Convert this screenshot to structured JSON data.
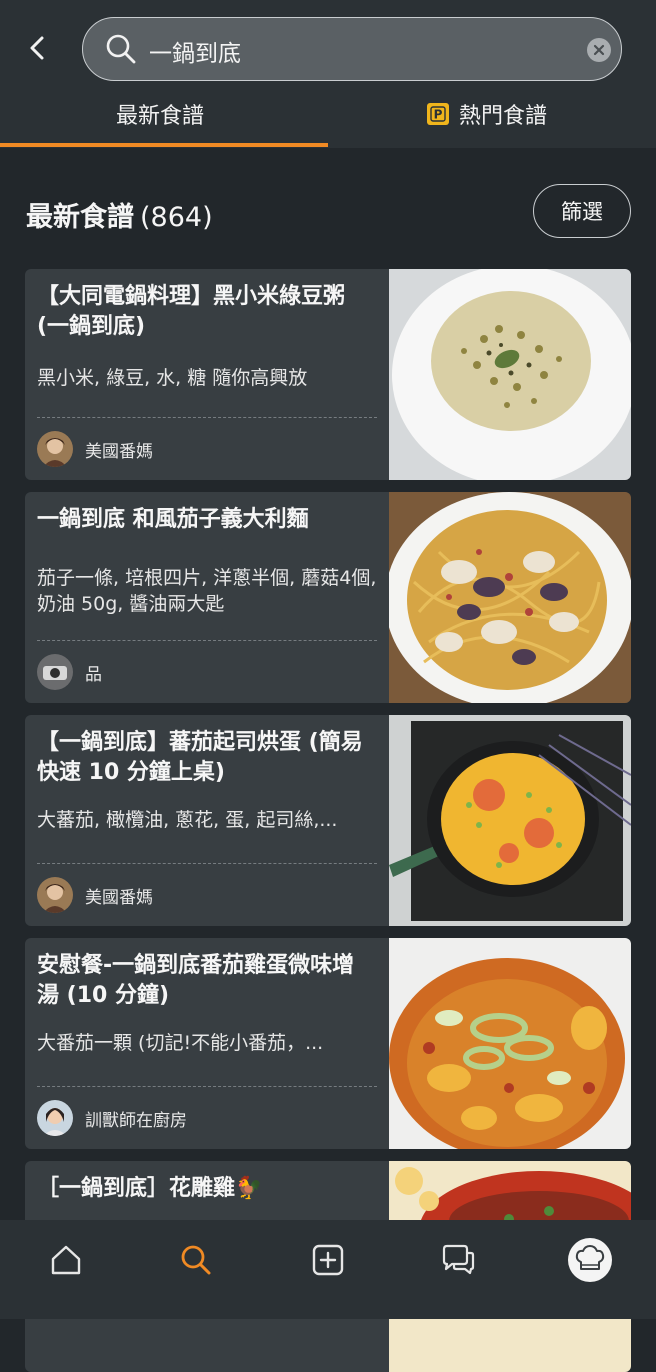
{
  "search": {
    "query": "一鍋到底"
  },
  "tabs": {
    "latest": "最新食譜",
    "popular": "熱門食譜"
  },
  "section": {
    "title": "最新食譜",
    "count": "(864)",
    "filter_label": "篩選"
  },
  "recipes": [
    {
      "title": "【大同電鍋料理】黑小米綠豆粥 (一鍋到底)",
      "ingredients": "黑小米, 綠豆, 水, 糖 隨你高興放",
      "author": "美國番媽"
    },
    {
      "title": "一鍋到底 和風茄子義大利麵",
      "ingredients": "茄子一條, 培根四片, 洋蔥半個, 蘑菇4個, 奶油 50g, 醬油兩大匙",
      "author": "品"
    },
    {
      "title": "【一鍋到底】蕃茄起司烘蛋 (簡易快速 10 分鐘上桌)",
      "ingredients": "大蕃茄, 橄欖油, 蔥花, 蛋, 起司絲,...",
      "author": "美國番媽"
    },
    {
      "title": "安慰餐-一鍋到底番茄雞蛋微味增湯 (10 分鐘)",
      "ingredients": "大番茄一顆 (切記!不能小番茄，...",
      "author": "訓獸師在廚房"
    },
    {
      "title": "［一鍋到底］花雕雞🐓"
    }
  ],
  "colors": {
    "accent": "#f08a24",
    "premium": "#f0b51c",
    "background": "#22272b",
    "card": "#383e42"
  }
}
